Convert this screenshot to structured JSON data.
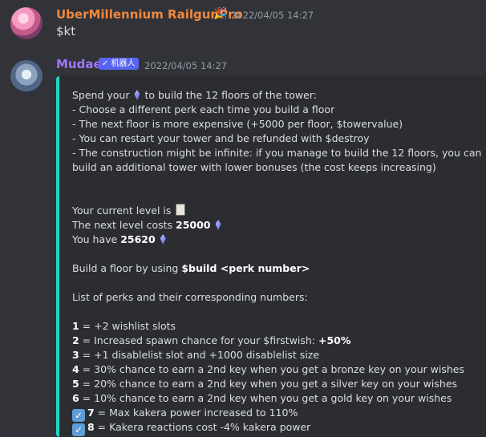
{
  "messages": [
    {
      "author": "UberMillennium RailgunPro",
      "author_color": "#f0883e",
      "badge_icon": "party-icon",
      "timestamp": "2022/04/05 14:27",
      "content": "$kt"
    },
    {
      "author": "Mudae",
      "author_color": "#a277ff",
      "bot_badge": "✓ 机器人",
      "timestamp": "2022/04/05 14:27",
      "embed": {
        "border_color": "#1fd6c8",
        "intro_pre": "Spend your",
        "intro_post": "to build the 12 floors of the tower:",
        "rules": [
          "- Choose a different perk each time you build a floor",
          "- The next floor is more expensive (+5000 per floor, $towervalue)",
          "- You can restart your tower and be refunded with $destroy",
          "- The construction might be infinite: if you manage to build the 12 floors, you can",
          "build an additional tower with lower bonuses (the cost keeps increasing)"
        ],
        "current_level_label": "Your current level is",
        "next_cost_label": "The next level costs",
        "next_cost_value": "25000",
        "have_label": "You have",
        "have_value": "25620",
        "build_label": "Build a floor by using",
        "build_command": "$build <perk number>",
        "perks_heading": "List of perks and their corresponding numbers:",
        "perks": [
          {
            "num": "1",
            "text": " = +2 wishlist slots",
            "checked": false
          },
          {
            "num": "2",
            "text": " = Increased spawn chance for your $firstwish: ",
            "bold_suffix": "+50%",
            "checked": false
          },
          {
            "num": "3",
            "text": " = +1 disablelist slot and +1000 disablelist size",
            "checked": false
          },
          {
            "num": "4",
            "text": " = 30% chance to earn a 2nd key when you get a bronze key on your wishes",
            "checked": false
          },
          {
            "num": "5",
            "text": " = 20% chance to earn a 2nd key when you get a silver key on your wishes",
            "checked": false
          },
          {
            "num": "6",
            "text": " = 10% chance to earn a 2nd key when you get a gold key on your wishes",
            "checked": false
          },
          {
            "num": "7",
            "text": " = Max kakera power increased to 110%",
            "checked": true
          },
          {
            "num": "8",
            "text": " = Kakera reactions cost -4% kakera power",
            "checked": true
          }
        ]
      }
    }
  ]
}
